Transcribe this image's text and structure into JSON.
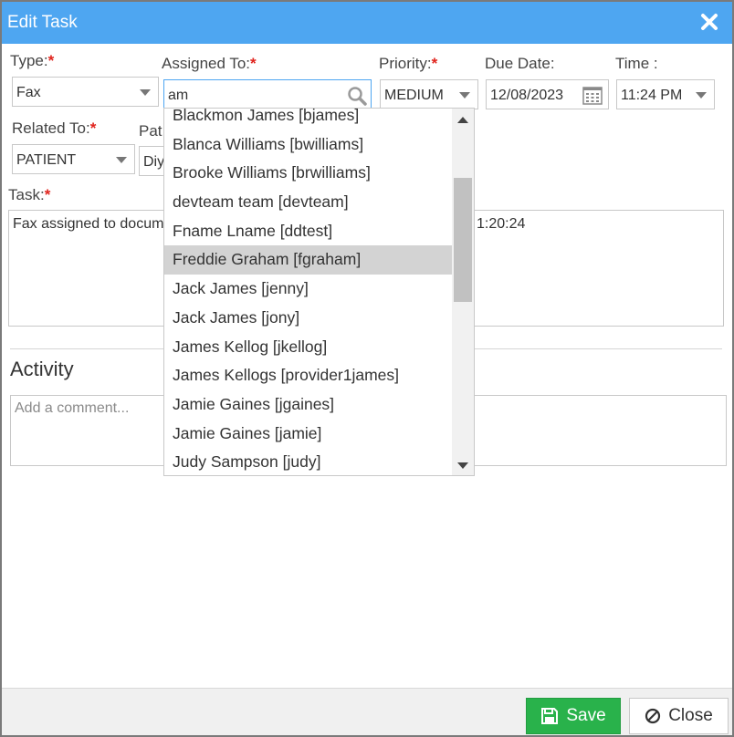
{
  "dialog": {
    "title": "Edit Task"
  },
  "form": {
    "type": {
      "label": "Type:",
      "required": "*",
      "value": "Fax"
    },
    "assigned_to": {
      "label": "Assigned To:",
      "required": "*",
      "value": "am"
    },
    "priority": {
      "label": "Priority:",
      "required": "*",
      "value": "MEDIUM"
    },
    "due_date": {
      "label": "Due Date:",
      "value": "12/08/2023"
    },
    "time": {
      "label": "Time :",
      "value": "11:24 PM"
    },
    "related_to": {
      "label": "Related To:",
      "required": "*",
      "value": "PATIENT"
    },
    "patient": {
      "label_visible": "Pat",
      "value_visible": "Diy"
    },
    "task": {
      "label": "Task:",
      "required": "*",
      "value_left": "Fax assigned to docum",
      "value_right": "1:20:24"
    }
  },
  "activity": {
    "title": "Activity",
    "comment_placeholder": "Add a comment..."
  },
  "assignee_dropdown": {
    "items": [
      "Blackmon James [bjames]",
      "Blanca Williams [bwilliams]",
      "Brooke Williams [brwilliams]",
      "devteam team [devteam]",
      "Fname Lname [ddtest]",
      "Freddie Graham [fgraham]",
      "Jack James [jenny]",
      "Jack James [jony]",
      "James Kellog [jkellog]",
      "James Kellogs [provider1james]",
      "Jamie Gaines [jgaines]",
      "Jamie Gaines [jamie]",
      "Judy Sampson [judy]"
    ],
    "highlighted": "Freddie Graham [fgraham]"
  },
  "footer": {
    "save_label": "Save",
    "close_label": "Close"
  },
  "colors": {
    "titlebar": "#4ea6f1",
    "save": "#29b24b",
    "required": "#e0231c",
    "highlight": "#d3d3d3"
  },
  "icons": {
    "close": "close-icon",
    "search": "search-icon",
    "calendar": "calendar-icon",
    "save": "save-icon",
    "cancel": "ban-icon"
  }
}
